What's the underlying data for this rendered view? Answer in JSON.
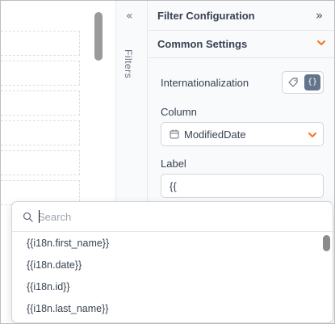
{
  "filters_strip": {
    "expand_glyph": "«",
    "label": "Filters"
  },
  "config_panel": {
    "title": "Filter Configuration",
    "collapse_glyph": "»",
    "section": {
      "title": "Common Settings"
    },
    "internationalization": {
      "label": "Internationalization",
      "code_toggle_glyph": "{}"
    },
    "column": {
      "label": "Column",
      "value": "ModifiedDate"
    },
    "label_field": {
      "label": "Label",
      "value": "{{"
    }
  },
  "dropdown": {
    "search_placeholder": "Search",
    "options": [
      "{{i18n.first_name}}",
      "{{i18n.date}}",
      "{{i18n.id}}",
      "{{i18n.last_name}}"
    ]
  },
  "colors": {
    "accent": "#f97316",
    "toggle_active": "#64748b",
    "panel_bg": "#f9fafb",
    "border": "#d1d5db"
  },
  "icons": {
    "chevron_accent": "chevron-down-icon",
    "column_type": "calendar-icon",
    "search": "search-icon",
    "tag": "tag-icon"
  }
}
